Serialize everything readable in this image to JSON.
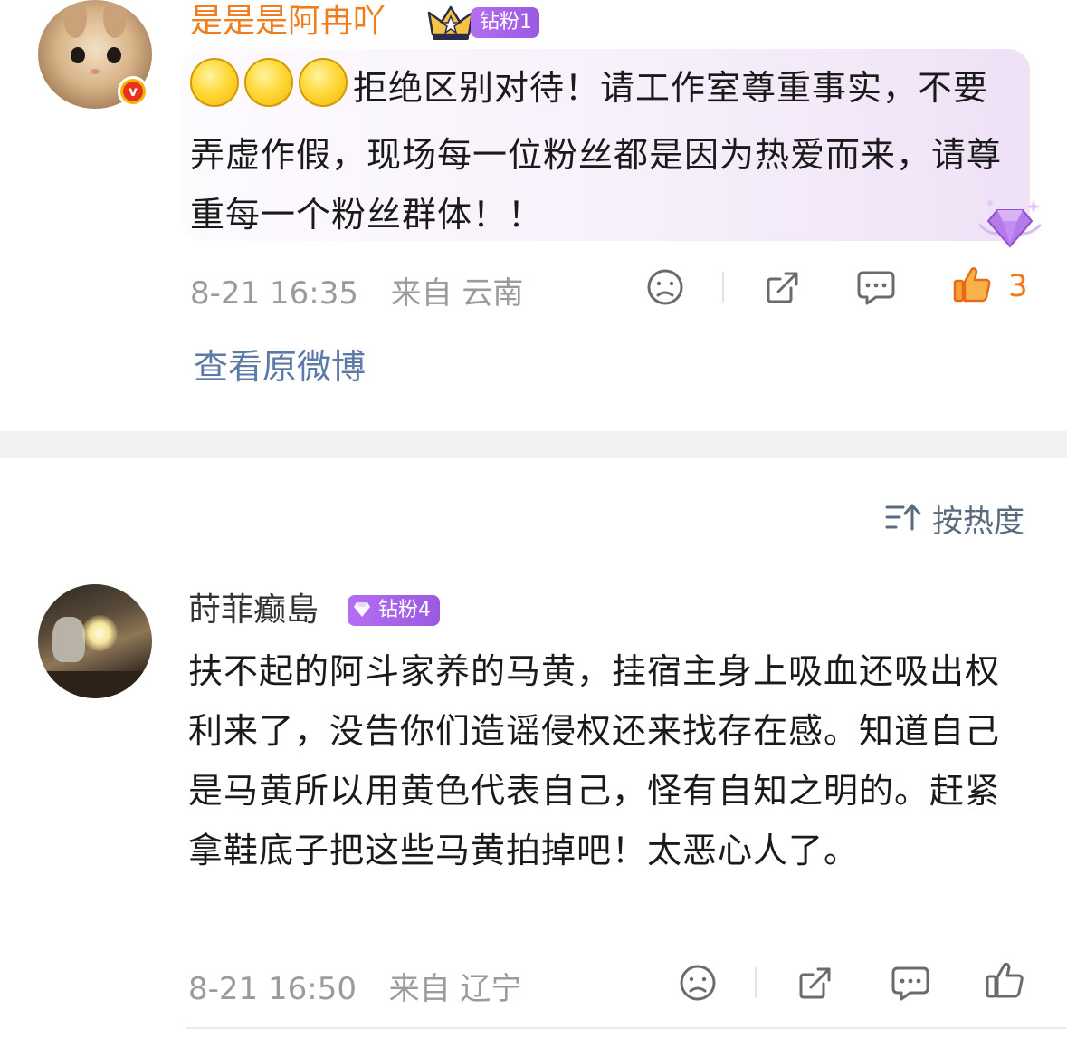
{
  "comments": [
    {
      "username": "是是是阿冉吖",
      "fan_badge": "钻粉1",
      "verified_badge_glyph": "v",
      "emoji_icons": [
        "yellow-circle-emoji",
        "yellow-circle-emoji",
        "yellow-circle-emoji"
      ],
      "text": "拒绝区别对待！请工作室尊重事实，不要弄虚作假，现场每一位粉丝都是因为热爱而来，请尊重每一个粉丝群体！！",
      "timestamp": "8-21 16:35",
      "location": "来自 云南",
      "like_count": "3",
      "liked": true,
      "view_original_label": "查看原微博"
    },
    {
      "username": "莳菲癫島",
      "fan_badge": "钻粉4",
      "text": "扶不起的阿斗家养的马黄，挂宿主身上吸血还吸出权利来了，没告你们造谣侵权还来找存在感。知道自己是马黄所以用黄色代表自己，怪有自知之明的。赶紧拿鞋底子把这些马黄拍掉吧！太恶心人了。",
      "timestamp": "8-21 16:50",
      "location": "来自 辽宁",
      "like_count": "",
      "liked": false
    }
  ],
  "sort": {
    "label": "按热度",
    "icon": "sort-icon"
  },
  "colors": {
    "username_vip": "#f07d1e",
    "username_normal": "#333333",
    "link_blue": "#5b7aa8",
    "meta_gray": "#9b9b9b",
    "like_orange": "#f27a1d",
    "fan_badge_purple": "#a862ea"
  }
}
